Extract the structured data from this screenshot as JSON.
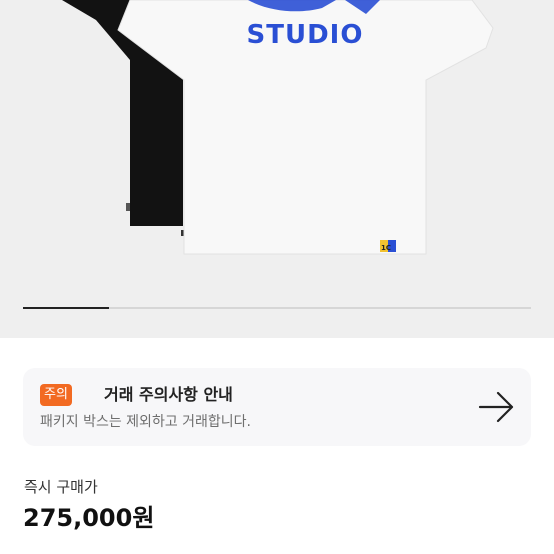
{
  "product": {
    "image_text": "STUDIO",
    "tag_text": "1C",
    "brand_blue": "#2a4fd4",
    "image_progress": 0.17
  },
  "notice": {
    "badge": "주의",
    "badge_color": "#f26a22",
    "title": "거래 주의사항 안내",
    "description": "패키지 박스는 제외하고 거래합니다.",
    "arrow_icon": "arrow-right-icon"
  },
  "price": {
    "label": "즉시 구매가",
    "value": "275,000원"
  }
}
